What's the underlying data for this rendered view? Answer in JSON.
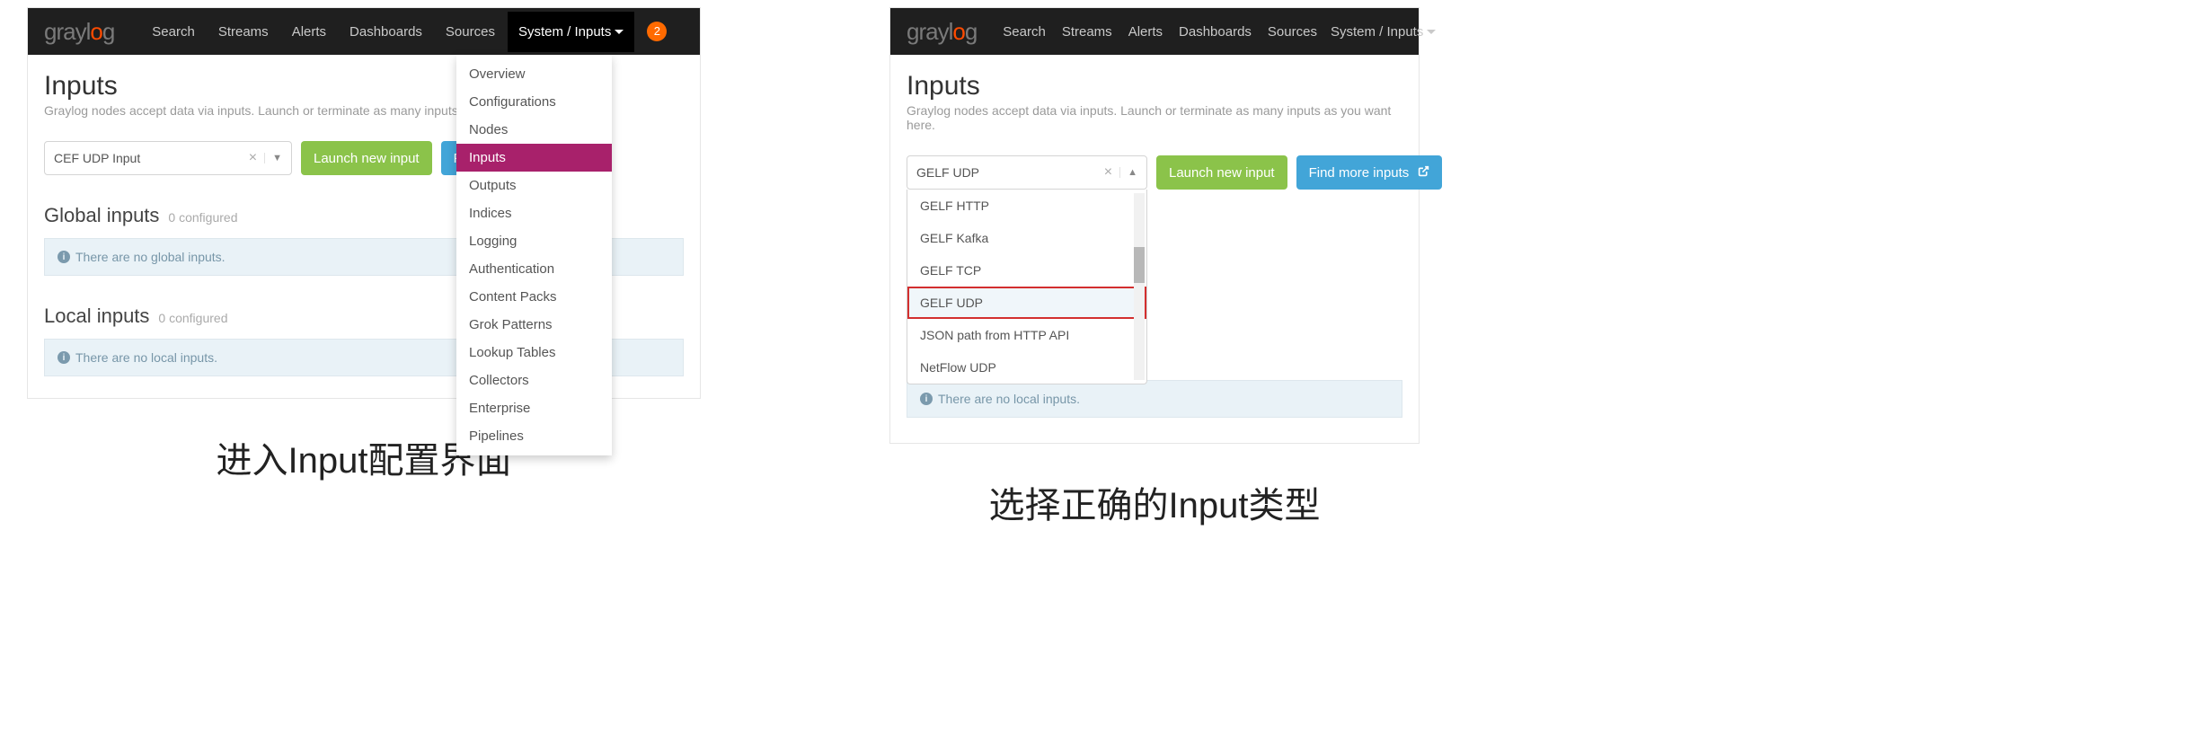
{
  "nav": {
    "items": [
      "Search",
      "Streams",
      "Alerts",
      "Dashboards",
      "Sources",
      "System / Inputs"
    ],
    "badge": "2"
  },
  "page": {
    "title": "Inputs",
    "subtitle": "Graylog nodes accept data via inputs. Launch or terminate as many inputs as you want here."
  },
  "buttons": {
    "launch": "Launch new input",
    "more": "Find more inputs",
    "more_short": "Find m"
  },
  "left": {
    "select_value": "CEF UDP Input",
    "dropdown": [
      "Overview",
      "Configurations",
      "Nodes",
      "Inputs",
      "Outputs",
      "Indices",
      "Logging",
      "Authentication",
      "Content Packs",
      "Grok Patterns",
      "Lookup Tables",
      "Collectors",
      "Enterprise",
      "Pipelines"
    ],
    "dropdown_active": "Inputs",
    "sections": {
      "global": {
        "title": "Global inputs",
        "count": "0 configured",
        "empty": "There are no global inputs."
      },
      "local": {
        "title": "Local inputs",
        "count": "0 configured",
        "empty": "There are no local inputs."
      }
    }
  },
  "right": {
    "select_value": "GELF UDP",
    "options": [
      "GELF HTTP",
      "GELF Kafka",
      "GELF TCP",
      "GELF UDP",
      "JSON path from HTTP API",
      "NetFlow UDP"
    ],
    "highlight": "GELF UDP",
    "local_empty": "There are no local inputs."
  },
  "captions": {
    "left": "进入Input配置界面",
    "right": "选择正确的Input类型"
  }
}
